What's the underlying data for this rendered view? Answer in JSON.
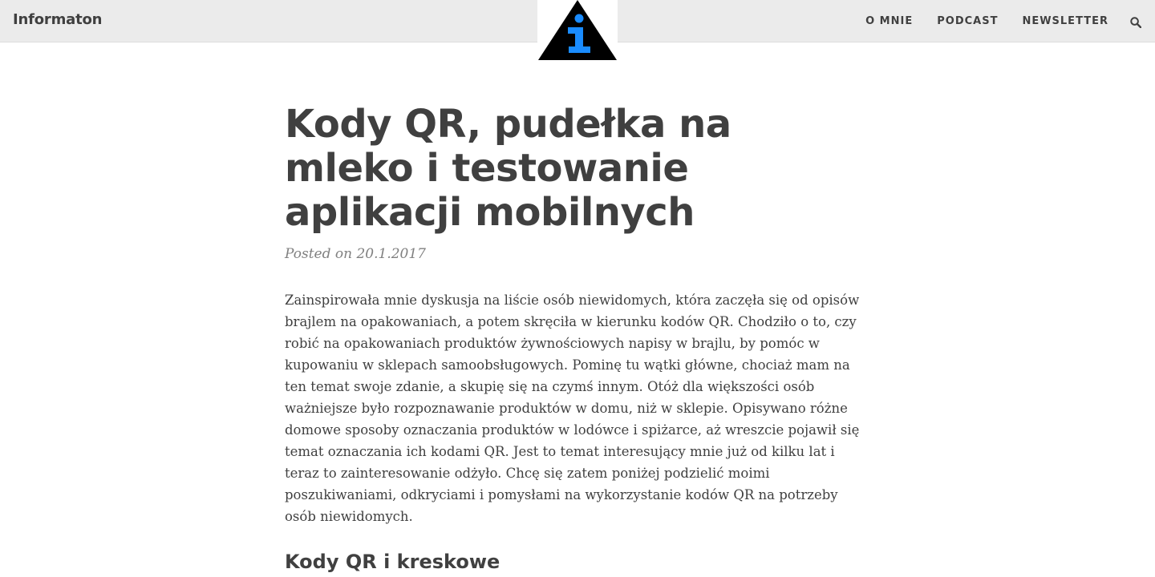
{
  "navbar": {
    "brand": "Informaton",
    "links": [
      "O MNIE",
      "PODCAST",
      "NEWSLETTER"
    ],
    "search_icon": "search-icon"
  },
  "logo": {
    "icon": "info-triangle-logo",
    "colors": {
      "triangle": "#000000",
      "letter": "#1a8cff"
    }
  },
  "article": {
    "title": "Kody QR, pudełka na mleko i testowanie aplikacji mobilnych",
    "meta": "Posted on 20.1.2017",
    "paragraph": "Zainspirowała mnie dyskusja na liście osób niewidomych, która zaczęła się od opisów brajlem na opakowaniach, a potem skręciła w kierunku kodów QR. Chodziło o to, czy robić na opakowaniach produktów żywnościowych napisy w brajlu, by pomóc w kupowaniu w sklepach samoobsługowych. Pominę tu wątki główne, chociaż mam na ten temat swoje zdanie, a skupię się na czymś innym. Otóż dla większości osób ważniejsze było rozpoznawanie produktów w domu, niż w sklepie. Opisywano różne domowe sposoby oznaczania produktów w lodówce i spiżarce, aż wreszcie pojawił się temat oznaczania ich kodami QR. Jest to temat interesujący mnie już od kilku lat i teraz to zainteresowanie odżyło. Chcę się zatem poniżej podzielić moimi poszukiwaniami, odkryciami i pomysłami na wykorzystanie kodów QR na potrzeby osób niewidomych.",
    "section_heading": "Kody QR i kreskowe"
  }
}
